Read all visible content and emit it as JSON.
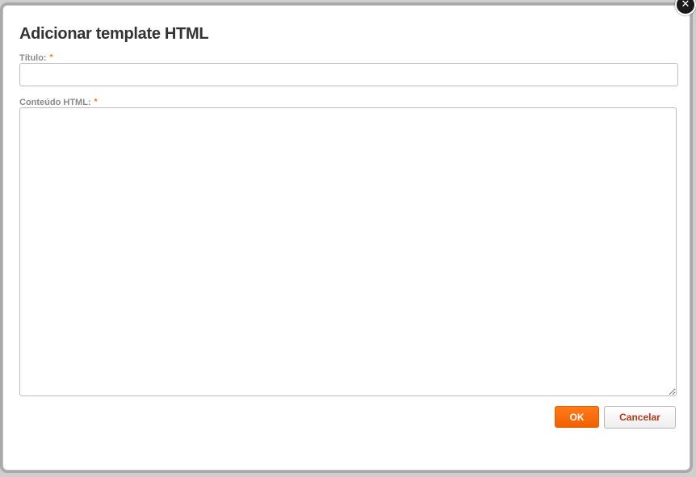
{
  "dialog": {
    "title": "Adicionar template HTML",
    "close_icon": "close-icon",
    "fields": {
      "titulo": {
        "label": "Título:",
        "required_marker": "*",
        "value": ""
      },
      "conteudo": {
        "label": "Conteúdo HTML:",
        "required_marker": "*",
        "value": ""
      }
    },
    "buttons": {
      "ok_label": "OK",
      "cancel_label": "Cancelar"
    }
  },
  "colors": {
    "accent": "#f26100",
    "required_marker": "#f07a00",
    "cancel_text": "#b33a1a"
  }
}
